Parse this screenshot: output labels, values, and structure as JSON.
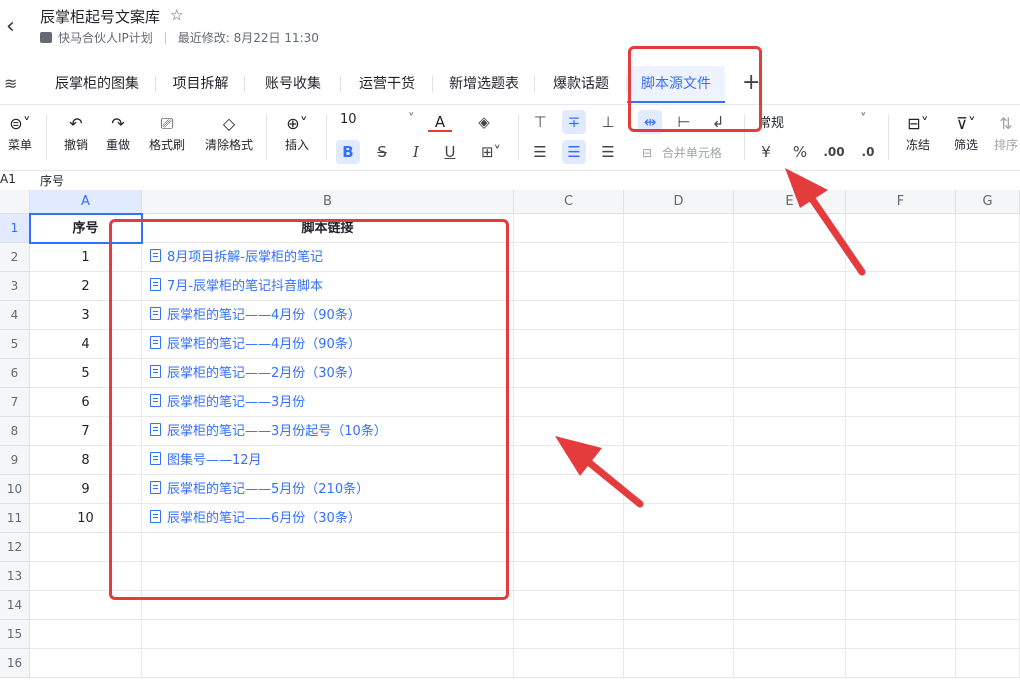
{
  "header": {
    "title": "辰掌柜起号文案库",
    "breadcrumb": "快马合伙人IP计划",
    "modified": "最近修改: 8月22日 11:30"
  },
  "tabs": [
    {
      "label": "辰掌柜的图集",
      "active": false
    },
    {
      "label": "项目拆解",
      "active": false
    },
    {
      "label": "账号收集",
      "active": false
    },
    {
      "label": "运营干货",
      "active": false
    },
    {
      "label": "新增选题表",
      "active": false
    },
    {
      "label": "爆款话题",
      "active": false
    },
    {
      "label": "脚本源文件",
      "active": true
    }
  ],
  "toolbar": {
    "menu": "菜单",
    "undo": "撤销",
    "redo": "重做",
    "format_painter": "格式刷",
    "clear_format": "清除格式",
    "insert": "插入",
    "font_size": "10",
    "merge_cells": "合并单元格",
    "number_format": "常规",
    "currency": "¥",
    "percent": "%",
    "decimal_inc": ".00",
    "decimal_dec": ".0",
    "freeze": "冻结",
    "filter": "筛选",
    "sort": "排序"
  },
  "formula_bar": {
    "ref": "A1",
    "value": "序号"
  },
  "columns": [
    "A",
    "B",
    "C",
    "D",
    "E",
    "F",
    "G"
  ],
  "rows": [
    "1",
    "2",
    "3",
    "4",
    "5",
    "6",
    "7",
    "8",
    "9",
    "10",
    "11",
    "12",
    "13",
    "14",
    "15",
    "16"
  ],
  "table": {
    "headers": [
      "序号",
      "脚本链接"
    ],
    "records": [
      {
        "no": "1",
        "link": "8月项目拆解-辰掌柜的笔记"
      },
      {
        "no": "2",
        "link": "7月-辰掌柜的笔记抖音脚本"
      },
      {
        "no": "3",
        "link": "辰掌柜的笔记——4月份（90条）"
      },
      {
        "no": "4",
        "link": "辰掌柜的笔记——4月份（90条）"
      },
      {
        "no": "5",
        "link": "辰掌柜的笔记——2月份（30条）"
      },
      {
        "no": "6",
        "link": "辰掌柜的笔记——3月份"
      },
      {
        "no": "7",
        "link": "辰掌柜的笔记——3月份起号（10条）"
      },
      {
        "no": "8",
        "link": "图集号——12月"
      },
      {
        "no": "9",
        "link": "辰掌柜的笔记——5月份（210条）"
      },
      {
        "no": "10",
        "link": "辰掌柜的笔记——6月份（30条）"
      }
    ]
  },
  "colors": {
    "accent": "#3370ff",
    "annotation": "#e43c3c"
  }
}
